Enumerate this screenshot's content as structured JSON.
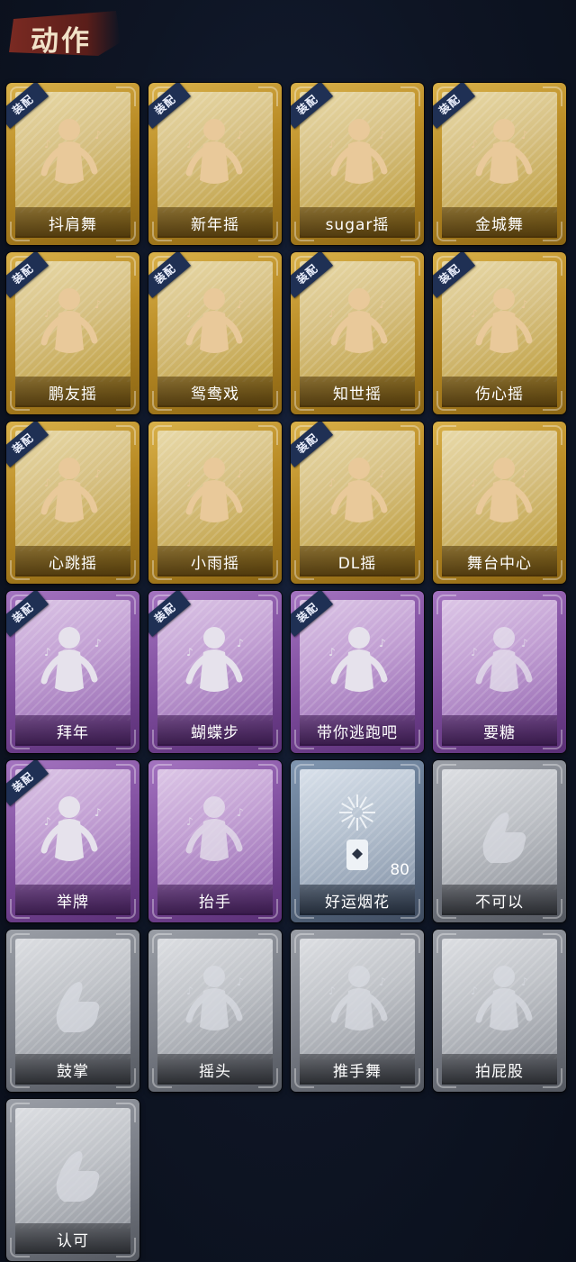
{
  "header": {
    "title": "动作"
  },
  "colors": {
    "gold": "#c89b2e",
    "purple": "#7e4c9d",
    "blue_gray": "#5c6e86",
    "silver": "#767a83",
    "equip_tag": "#1f3054",
    "background": "#0e1524"
  },
  "equip_tag_label": "装配",
  "actions": [
    {
      "label": "抖肩舞",
      "tier": "gold",
      "equipped": true,
      "icon": "shrug-dance-figure-icon"
    },
    {
      "label": "新年摇",
      "tier": "gold",
      "equipped": true,
      "icon": "new-year-sway-figure-icon"
    },
    {
      "label": "sugar摇",
      "tier": "gold",
      "equipped": true,
      "icon": "sugar-sway-figure-icon"
    },
    {
      "label": "金城舞",
      "tier": "gold",
      "equipped": true,
      "icon": "jincheng-dance-figure-icon"
    },
    {
      "label": "鹏友摇",
      "tier": "gold",
      "equipped": true,
      "icon": "pengyou-sway-figure-icon"
    },
    {
      "label": "鸳鸯戏",
      "tier": "gold",
      "equipped": true,
      "icon": "mandarin-duck-figure-icon"
    },
    {
      "label": "知世摇",
      "tier": "gold",
      "equipped": true,
      "icon": "zhishi-sway-figure-icon"
    },
    {
      "label": "伤心摇",
      "tier": "gold",
      "equipped": true,
      "icon": "heart-hands-figure-icon"
    },
    {
      "label": "心跳摇",
      "tier": "gold",
      "equipped": true,
      "icon": "heartbeat-sway-figure-icon"
    },
    {
      "label": "小雨摇",
      "tier": "gold",
      "equipped": false,
      "icon": "light-rain-sway-figure-icon"
    },
    {
      "label": "DL摇",
      "tier": "gold",
      "equipped": true,
      "icon": "dl-sway-figure-icon"
    },
    {
      "label": "舞台中心",
      "tier": "gold",
      "equipped": false,
      "icon": "center-stage-figure-icon"
    },
    {
      "label": "拜年",
      "tier": "purple",
      "equipped": true,
      "icon": "new-year-greeting-figure-icon"
    },
    {
      "label": "蝴蝶步",
      "tier": "purple",
      "equipped": true,
      "icon": "butterfly-step-figure-icon"
    },
    {
      "label": "带你逃跑吧",
      "tier": "purple",
      "equipped": true,
      "icon": "run-away-figure-icon"
    },
    {
      "label": "要糖",
      "tier": "purple",
      "equipped": false,
      "icon": "ask-candy-figure-icon"
    },
    {
      "label": "举牌",
      "tier": "purple",
      "equipped": true,
      "icon": "hold-sign-figure-icon"
    },
    {
      "label": "抬手",
      "tier": "purple",
      "equipped": false,
      "icon": "raise-hand-figure-icon"
    },
    {
      "label": "好运烟花",
      "tier": "blue",
      "equipped": false,
      "icon": "lucky-firework-icon",
      "count": "80"
    },
    {
      "label": "不可以",
      "tier": "silver",
      "equipped": false,
      "icon": "wagging-finger-icon"
    },
    {
      "label": "鼓掌",
      "tier": "silver",
      "equipped": false,
      "icon": "clapping-hands-icon"
    },
    {
      "label": "摇头",
      "tier": "silver",
      "equipped": false,
      "icon": "shake-head-figure-icon"
    },
    {
      "label": "推手舞",
      "tier": "silver",
      "equipped": false,
      "icon": "push-hands-dance-figure-icon"
    },
    {
      "label": "拍屁股",
      "tier": "silver",
      "equipped": false,
      "icon": "pat-butt-figure-icon"
    },
    {
      "label": "认可",
      "tier": "silver",
      "equipped": false,
      "icon": "thumbs-up-icon"
    }
  ]
}
